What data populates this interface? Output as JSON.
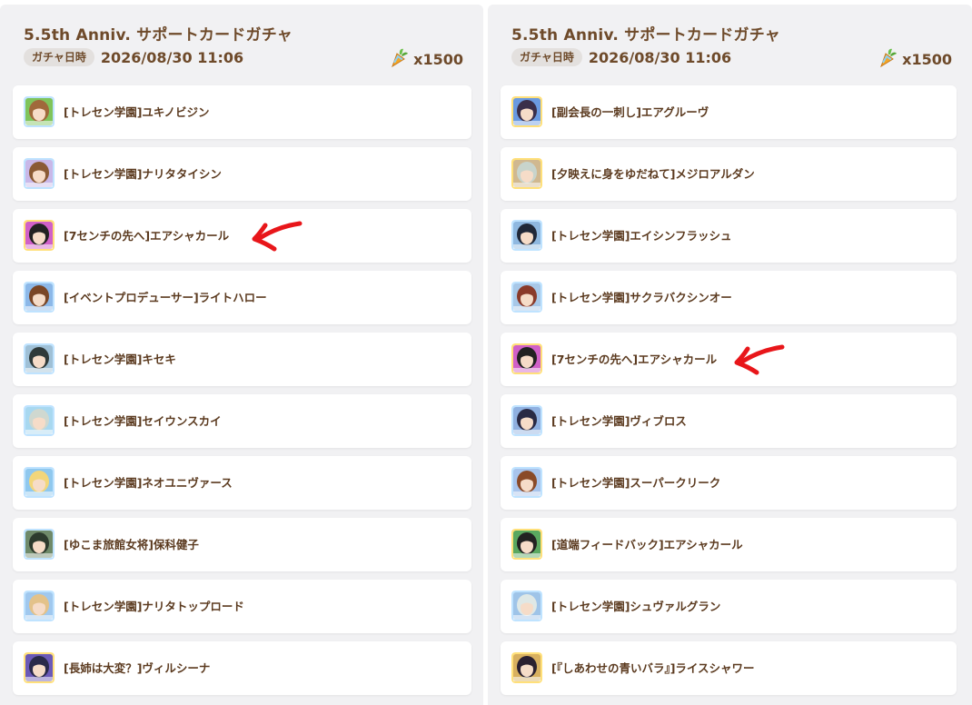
{
  "panels": [
    {
      "title": "5.5th Anniv. サポートカードガチャ",
      "date_label": "ガチャ日時",
      "date_value": "2026/08/30 11:06",
      "cost": "x1500",
      "cost_icon": "carrot-icon",
      "cards": [
        {
          "name": "[トレセン学園]ユキノビジン",
          "frame": "#bfe3ff",
          "hair": "#a0693b",
          "bg": "#7fc45b"
        },
        {
          "name": "[トレセン学園]ナリタタイシン",
          "frame": "#bfe3ff",
          "hair": "#8a5a34",
          "bg": "#c9b8e8"
        },
        {
          "name": "[7センチの先へ]エアシャカール",
          "frame": "#ffe07a",
          "hair": "#222222",
          "bg": "#d060c8",
          "highlighted": true
        },
        {
          "name": "[イベントプロデューサー]ライトハロー",
          "frame": "#bfe3ff",
          "hair": "#7a4626",
          "bg": "#8cb8e8"
        },
        {
          "name": "[トレセン学園]キセキ",
          "frame": "#bfe3ff",
          "hair": "#2f3a3a",
          "bg": "#9fc0d6"
        },
        {
          "name": "[トレセン学園]セイウンスカイ",
          "frame": "#bfe3ff",
          "hair": "#cfd8d0",
          "bg": "#a8d8f0"
        },
        {
          "name": "[トレセン学園]ネオユニヴァース",
          "frame": "#bfe3ff",
          "hair": "#f2d67a",
          "bg": "#8fc8ee"
        },
        {
          "name": "[ゆこま旅館女将]保科健子",
          "frame": "#bfe3ff",
          "hair": "#2d3b2e",
          "bg": "#6f8a6a"
        },
        {
          "name": "[トレセン学園]ナリタトップロード",
          "frame": "#bfe3ff",
          "hair": "#e3c28a",
          "bg": "#a0c8ee"
        },
        {
          "name": "[長姉は大変？]ヴィルシーナ",
          "frame": "#ffe07a",
          "hair": "#2a2a4a",
          "bg": "#6b5ab8"
        }
      ]
    },
    {
      "title": "5.5th Anniv. サポートカードガチャ",
      "date_label": "ガチャ日時",
      "date_value": "2026/08/30 11:06",
      "cost": "x1500",
      "cost_icon": "carrot-icon",
      "cards": [
        {
          "name": "[副会長の一刺し]エアグルーヴ",
          "frame": "#ffe07a",
          "hair": "#3a2f4a",
          "bg": "#6a9ae0"
        },
        {
          "name": "[夕映えに身をゆだねて]メジロアルダン",
          "frame": "#ffe07a",
          "hair": "#c8d4cc",
          "bg": "#d0b890"
        },
        {
          "name": "[トレセン学園]エイシンフラッシュ",
          "frame": "#bfe3ff",
          "hair": "#202838",
          "bg": "#8fb8e0"
        },
        {
          "name": "[トレセン学園]サクラバクシンオー",
          "frame": "#bfe3ff",
          "hair": "#8a3a2a",
          "bg": "#a8c8e8"
        },
        {
          "name": "[7センチの先へ]エアシャカール",
          "frame": "#ffe07a",
          "hair": "#222222",
          "bg": "#d060c8",
          "highlighted": true
        },
        {
          "name": "[トレセン学園]ヴィブロス",
          "frame": "#bfe3ff",
          "hair": "#2a2a44",
          "bg": "#8fb0e0"
        },
        {
          "name": "[トレセン学園]スーパークリーク",
          "frame": "#bfe3ff",
          "hair": "#8a4a28",
          "bg": "#a8c4ec"
        },
        {
          "name": "[道端フィードバック]エアシャカール",
          "frame": "#ffe07a",
          "hair": "#222222",
          "bg": "#5aa860"
        },
        {
          "name": "[トレセン学園]シュヴァルグラン",
          "frame": "#bfe3ff",
          "hair": "#dfe8e6",
          "bg": "#9fc4e8"
        },
        {
          "name": "[『しあわせの青いバラ』]ライスシャワー",
          "frame": "#ffe07a",
          "hair": "#2a2030",
          "bg": "#d8b060"
        }
      ]
    }
  ],
  "annotation_color": "#e8161a"
}
